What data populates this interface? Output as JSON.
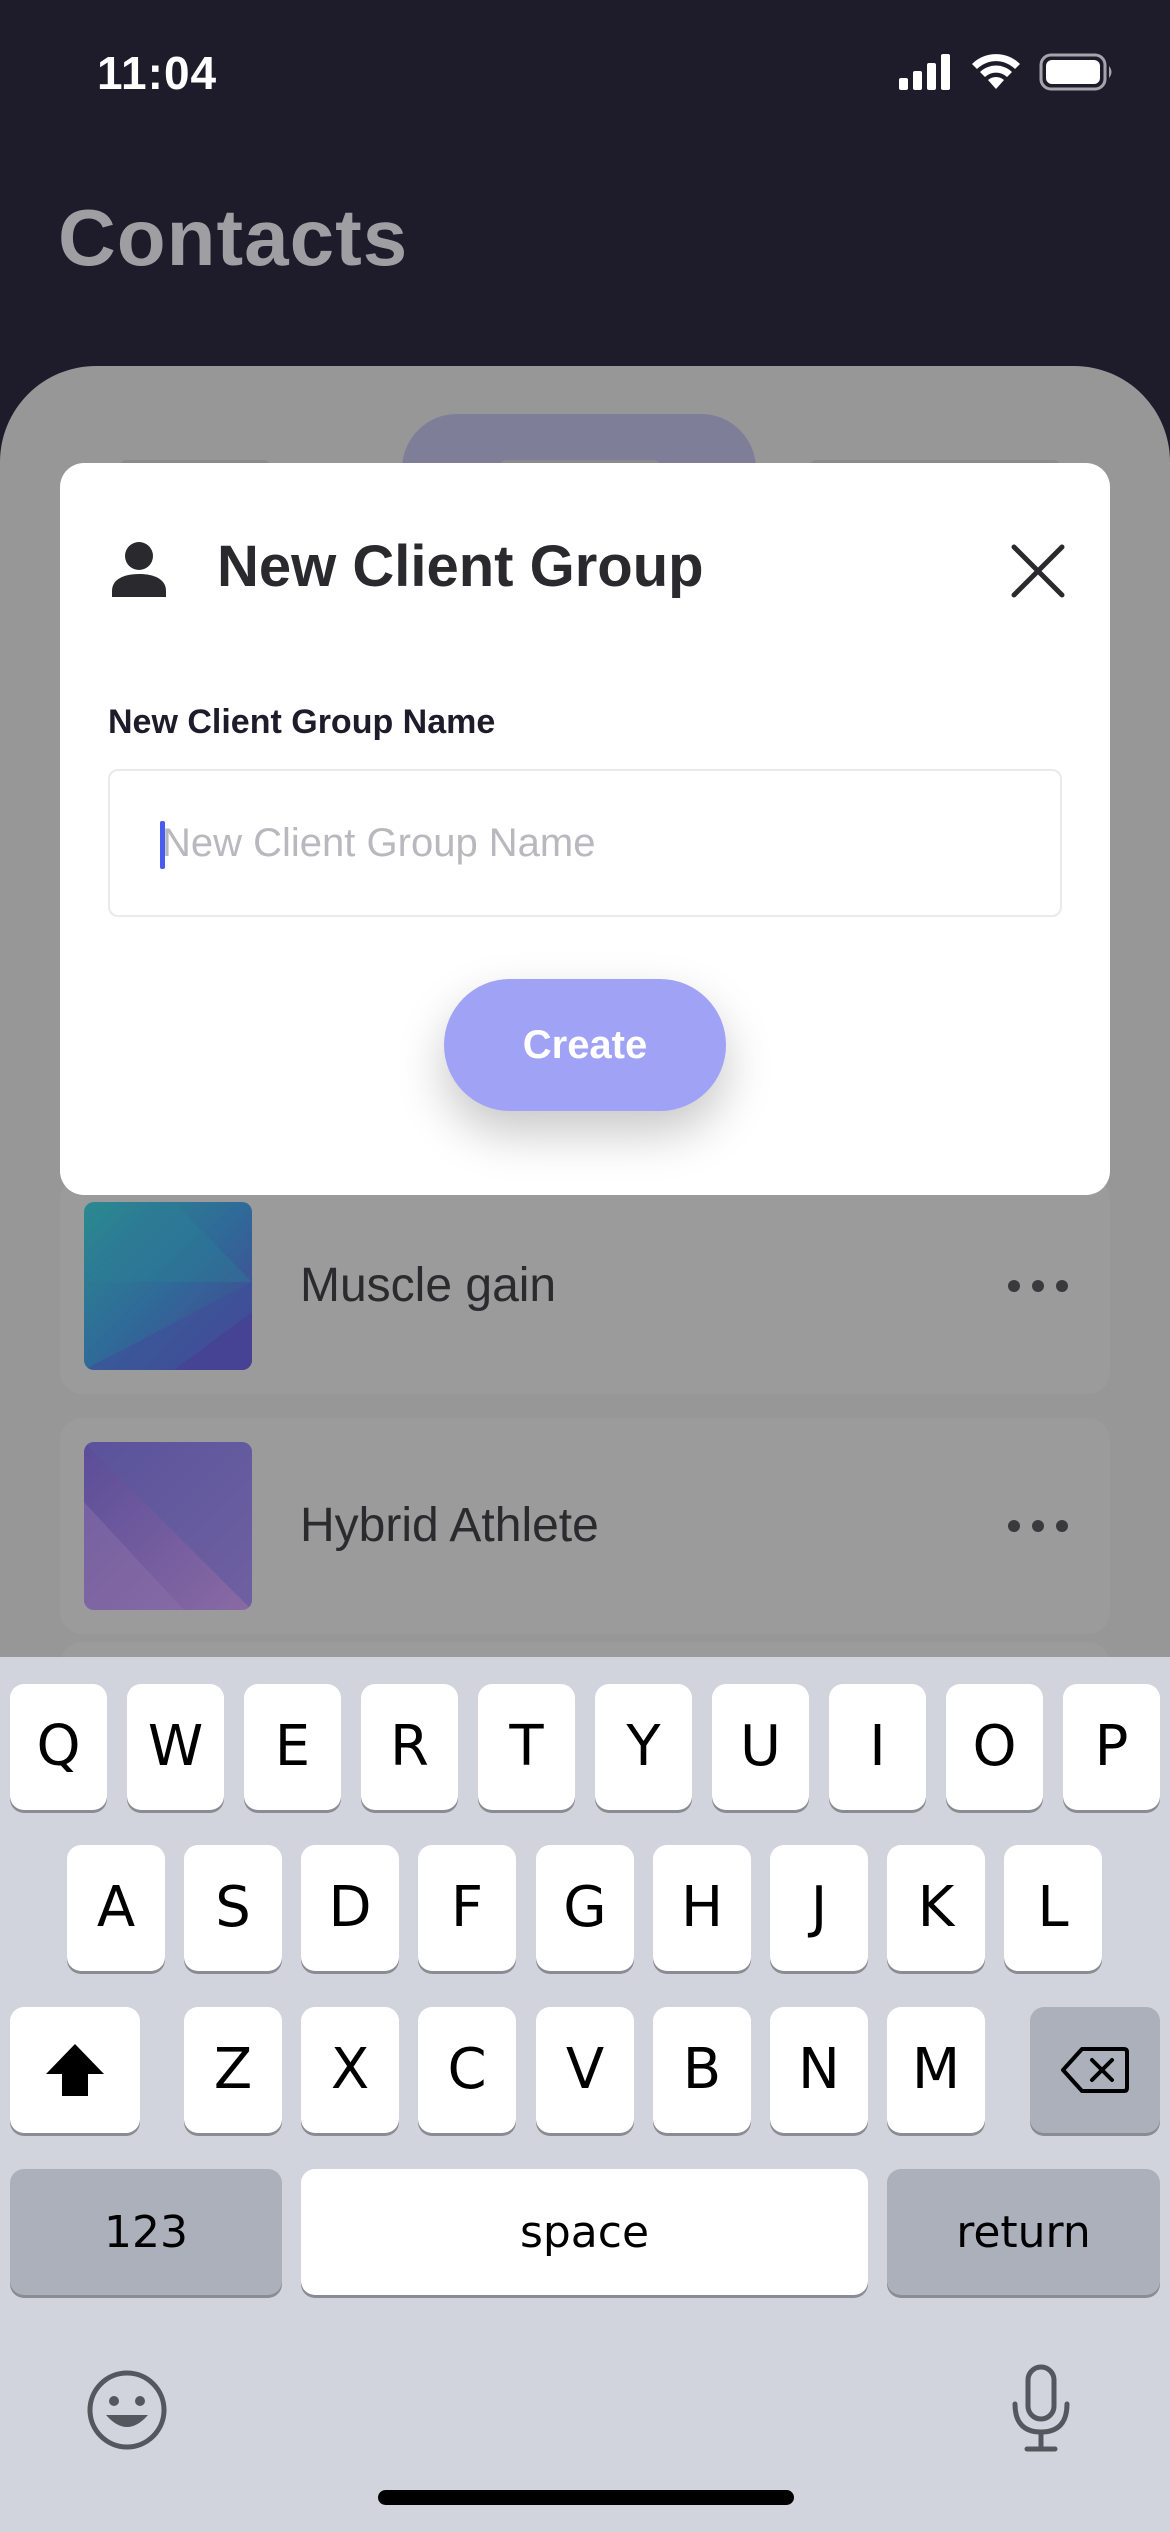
{
  "status_bar": {
    "time": "11:04",
    "icons": [
      "cellular-signal-icon",
      "wifi-icon",
      "battery-icon"
    ]
  },
  "screen": {
    "title": "Contacts"
  },
  "groups": [
    {
      "name": "Muscle gain",
      "more_icon": "more-horizontal-icon"
    },
    {
      "name": "Hybrid Athlete",
      "more_icon": "more-horizontal-icon"
    }
  ],
  "modal": {
    "title": "New Client Group",
    "icon": "user-icon",
    "close_icon": "close-icon",
    "field_label": "New Client Group Name",
    "field_placeholder": "New Client Group Name",
    "field_value": "",
    "create_label": "Create"
  },
  "keyboard": {
    "row1": [
      "Q",
      "W",
      "E",
      "R",
      "T",
      "Y",
      "U",
      "I",
      "O",
      "P"
    ],
    "row2": [
      "A",
      "S",
      "D",
      "F",
      "G",
      "H",
      "J",
      "K",
      "L"
    ],
    "row3": [
      "Z",
      "X",
      "C",
      "V",
      "B",
      "N",
      "M"
    ],
    "numbers_label": "123",
    "space_label": "space",
    "return_label": "return",
    "shift_icon": "shift-icon",
    "delete_icon": "delete-icon",
    "emoji_icon": "emoji-icon",
    "mic_icon": "microphone-icon"
  },
  "colors": {
    "header_bg": "#1e1c2b",
    "accent": "#9fa2f5",
    "caret": "#4a5cf0"
  }
}
